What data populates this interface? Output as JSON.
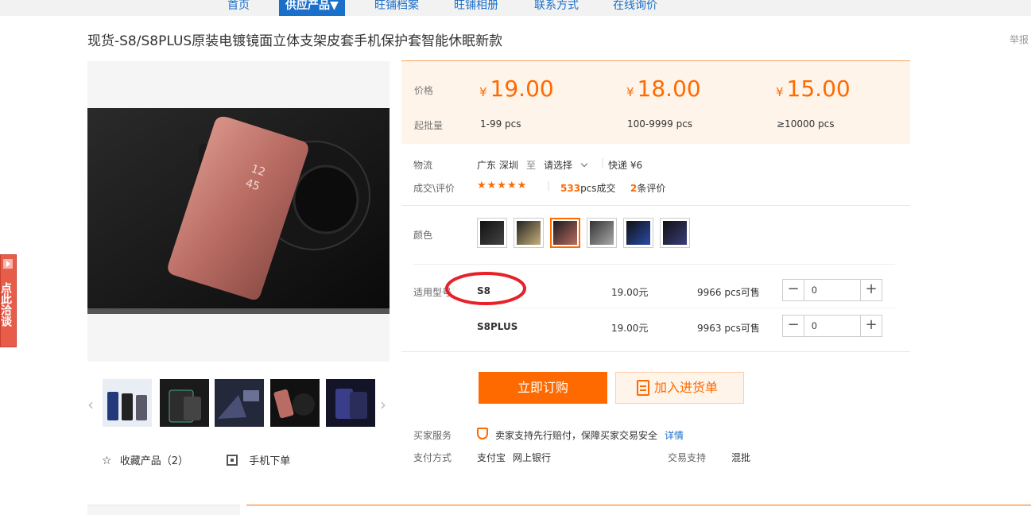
{
  "nav": {
    "items": [
      "首页",
      "供应产品▼",
      "旺铺档案",
      "旺铺相册",
      "联系方式",
      "在线询价"
    ]
  },
  "product": {
    "title": "现货-S8/S8PLUS原装电镀镜面立体支架皮套手机保护套智能休眠新款",
    "report": "举报"
  },
  "side_tab": {
    "text": "点此洽谈"
  },
  "gallery": {
    "favorite": "收藏产品（2）",
    "mobile_order": "手机下单"
  },
  "price": {
    "price_label": "价格",
    "moq_label": "起批量",
    "currency": "¥",
    "tiers": [
      {
        "price": "19.00",
        "range": "1-99 pcs"
      },
      {
        "price": "18.00",
        "range": "100-9999 pcs"
      },
      {
        "price": "15.00",
        "range": "≥10000 pcs"
      }
    ]
  },
  "logistics": {
    "label": "物流",
    "from": "广东 深圳",
    "to_word": "至",
    "dest": "请选择",
    "express": "快递 ¥6"
  },
  "deals": {
    "label": "成交\\评价",
    "stars": "★★★★★",
    "count": "533",
    "count_unit": "pcs成交",
    "reviews": "2",
    "reviews_unit": "条评价"
  },
  "color": {
    "label": "颜色",
    "selected_index": 2
  },
  "models": {
    "label": "适用型号",
    "rows": [
      {
        "name": "S8",
        "price": "19.00元",
        "stock": "9966 pcs可售",
        "qty": "0"
      },
      {
        "name": "S8PLUS",
        "price": "19.00元",
        "stock": "9963 pcs可售",
        "qty": "0"
      }
    ]
  },
  "actions": {
    "buy": "立即订购",
    "cart": "加入进货单"
  },
  "service": {
    "label": "买家服务",
    "text": "卖家支持先行赔付，保障买家交易安全",
    "detail": "详情"
  },
  "payment": {
    "label": "支付方式",
    "methods": [
      "支付宝",
      "网上银行"
    ],
    "trade_label": "交易支持",
    "trade_value": "混批"
  },
  "colors": {
    "accent": "#ff6a00",
    "nav_blue": "#1a6fc9",
    "annotation": "#e8202a"
  }
}
